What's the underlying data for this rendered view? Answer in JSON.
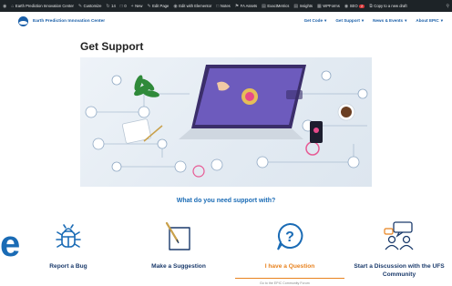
{
  "admin_bar": {
    "items": [
      {
        "icon": "wordpress-icon",
        "label": ""
      },
      {
        "icon": "home-icon",
        "label": "Earth Prediction Innovation Center"
      },
      {
        "icon": "brush-icon",
        "label": "Customize"
      },
      {
        "icon": "refresh-icon",
        "label": "14"
      },
      {
        "icon": "comment-icon",
        "label": "0"
      },
      {
        "icon": "plus-icon",
        "label": "New"
      },
      {
        "icon": "pencil-icon",
        "label": "Edit Page"
      },
      {
        "icon": "elementor-icon",
        "label": "Edit with Elementor"
      },
      {
        "icon": "notes-icon",
        "label": "Notes"
      },
      {
        "icon": "fa-icon",
        "label": "FA Assets"
      },
      {
        "icon": "chart-icon",
        "label": "ExactMetrics"
      },
      {
        "icon": "insights-icon",
        "label": "Insights"
      },
      {
        "icon": "wpforms-icon",
        "label": "WPForms"
      },
      {
        "icon": "seo-icon",
        "label": "SEO"
      },
      {
        "icon": "copy-icon",
        "label": "Copy to a new draft"
      }
    ],
    "seo_badge": "2"
  },
  "site": {
    "title": "Earth Prediction Innovation Center",
    "nav": [
      "Get Code",
      "Get Support",
      "News & Events",
      "About EPIC"
    ]
  },
  "page": {
    "title": "Get Support",
    "question": "What do you need support with?",
    "side_glyph": "e",
    "sub_text": "Go to the EPIC Community Forum"
  },
  "cards": [
    {
      "label": "Report a Bug",
      "icon": "bug-icon",
      "active": false
    },
    {
      "label": "Make a Suggestion",
      "icon": "notepad-pencil-icon",
      "active": false
    },
    {
      "label": "I have a Question",
      "icon": "question-bubble-icon",
      "active": true
    },
    {
      "label": "Start a Discussion with the UFS Community",
      "icon": "discussion-people-icon",
      "active": false
    }
  ],
  "colors": {
    "accent": "#1a6bb5",
    "active": "#e8821e",
    "card_label": "#1a3a6b",
    "admin_bar": "#1d2327"
  }
}
